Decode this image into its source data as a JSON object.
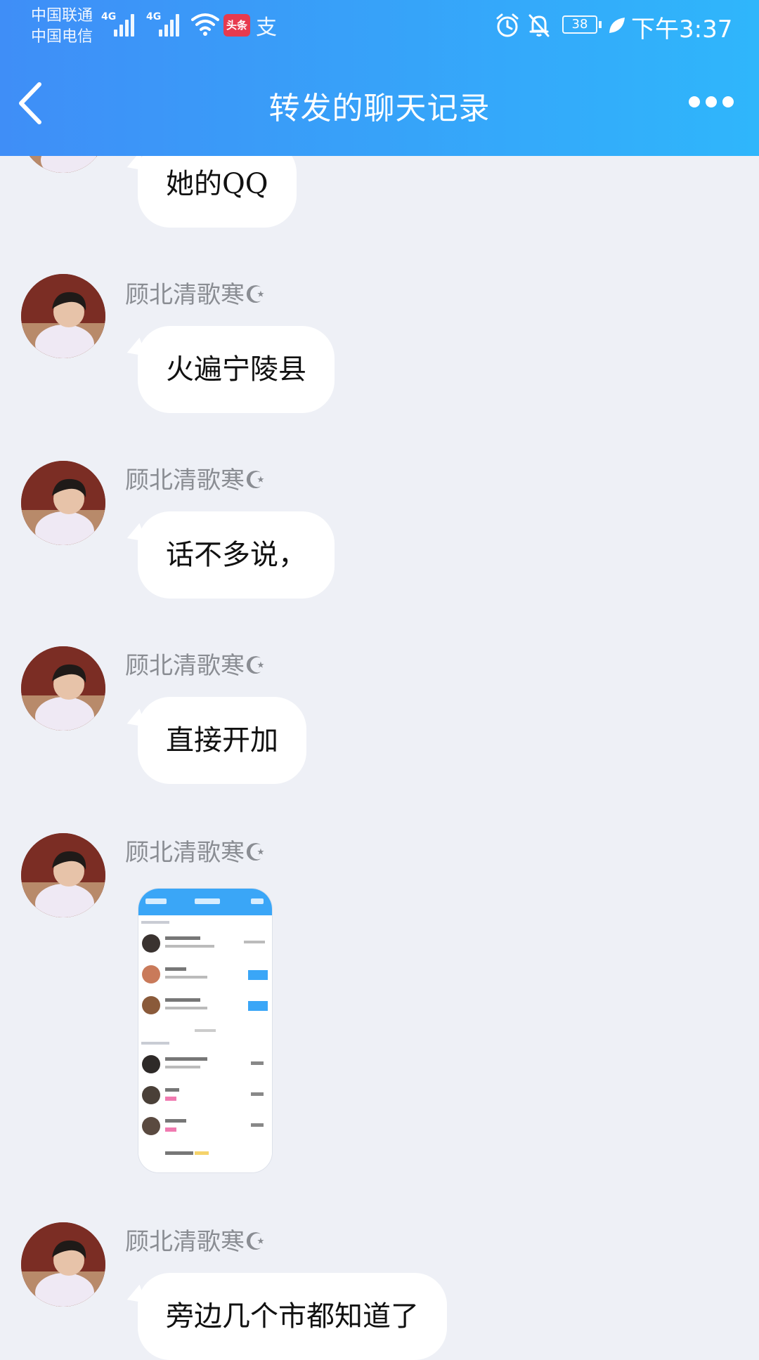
{
  "status_bar": {
    "carrier_1": "中国联通",
    "carrier_2": "中国电信",
    "net_1": "4G",
    "net_2": "4G",
    "toutiao": "头条",
    "alipay": "支",
    "battery": "38",
    "time": "下午3:37"
  },
  "header": {
    "title": "转发的聊天记录",
    "back_icon": "chevron-left-icon",
    "more_icon": "more-dots-icon"
  },
  "messages": [
    {
      "sender": "",
      "text": "她的QQ"
    },
    {
      "sender": "顾北清歌寒☪",
      "text": "火遍宁陵县"
    },
    {
      "sender": "顾北清歌寒☪",
      "text": "话不多说，"
    },
    {
      "sender": "顾北清歌寒☪",
      "text": "直接开加"
    },
    {
      "sender": "顾北清歌寒☪",
      "type": "image"
    },
    {
      "sender": "顾北清歌寒☪",
      "text": "旁边几个市都知道了"
    }
  ]
}
